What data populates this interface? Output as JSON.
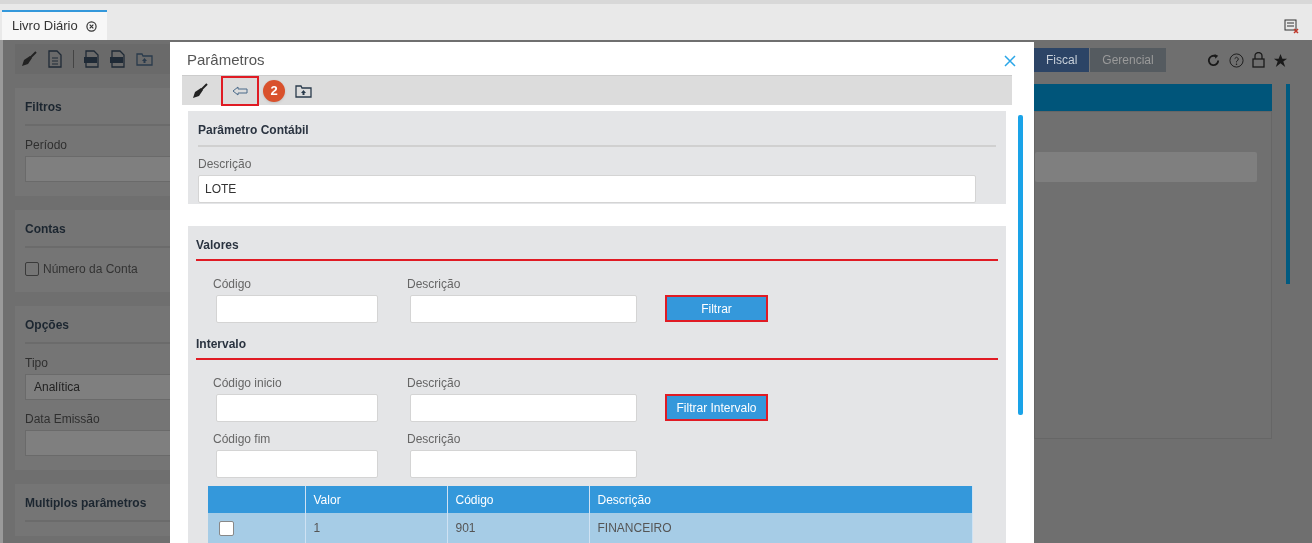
{
  "app_tabs": [
    {
      "label": "Livro Diário",
      "selected": true
    }
  ],
  "left_panels": [
    {
      "title": "Filtros",
      "items": [
        {
          "kind": "field",
          "label": "Período"
        }
      ]
    },
    {
      "title": "Contas",
      "items": [
        {
          "kind": "checkbox",
          "label": "Número da Conta",
          "checked": false
        }
      ]
    },
    {
      "title": "Opções",
      "items": [
        {
          "kind": "field",
          "label": "Tipo",
          "value": "Analítica"
        },
        {
          "kind": "field",
          "label": "Data Emissão"
        }
      ]
    },
    {
      "title": "Multiplos parâmetros"
    }
  ],
  "mode_tabs": [
    {
      "label": "Fiscal",
      "selected": true
    },
    {
      "label": "Gerencial",
      "selected": false
    }
  ],
  "dialog": {
    "title": "Parâmetros",
    "back_highlighted": true,
    "step_badge": "2",
    "param_section": {
      "title": "Parâmetro Contábil",
      "label": "Descrição",
      "value": "LOTE"
    },
    "filter_sections": [
      {
        "title": "Valores",
        "underlined": true,
        "rows": [
          [
            {
              "label": "Código"
            },
            {
              "label": "Descrição"
            }
          ]
        ],
        "button": {
          "label": "Filtrar",
          "highlighted": true
        }
      },
      {
        "title": "Intervalo",
        "underlined": true,
        "rows": [
          [
            {
              "label": "Código inicio"
            },
            {
              "label": "Descrição"
            }
          ],
          [
            {
              "label": "Código fim"
            },
            {
              "label": "Descrição"
            }
          ]
        ],
        "button": {
          "label": "Filtrar Intervalo",
          "highlighted": true
        }
      }
    ],
    "table": {
      "columns": [
        "Valor",
        "Código",
        "Descrição"
      ],
      "rows": [
        {
          "checked": false,
          "selected": true,
          "cells": [
            "1",
            "901",
            "FINANCEIRO"
          ]
        }
      ]
    }
  }
}
